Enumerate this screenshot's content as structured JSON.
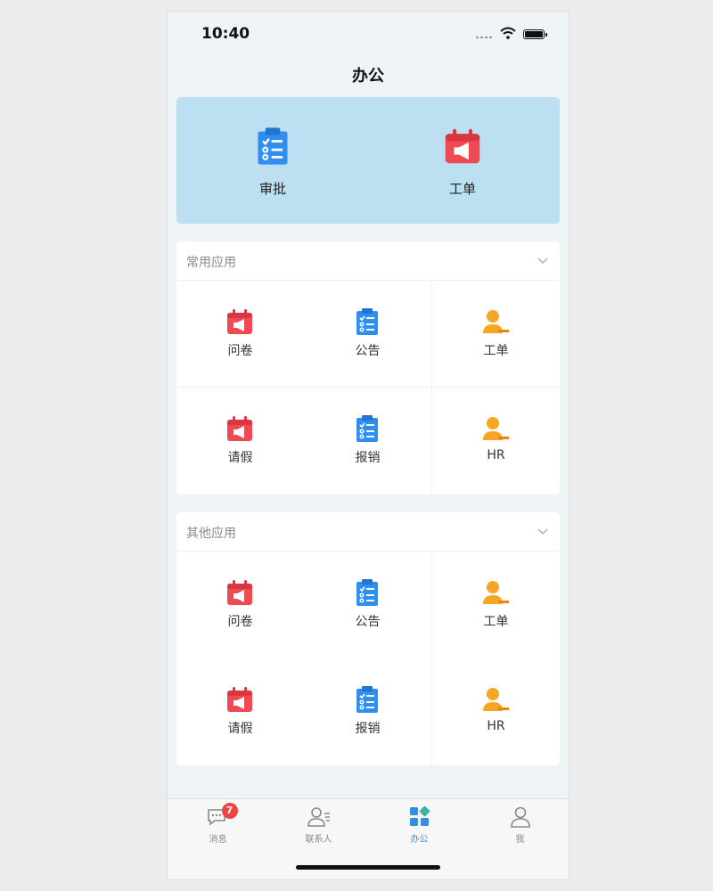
{
  "status_bar": {
    "time": "10:40"
  },
  "header": {
    "title": "办公"
  },
  "hero": {
    "items": [
      {
        "label": "审批",
        "icon": "clipboard-icon",
        "color": "#2f8ff0"
      },
      {
        "label": "工单",
        "icon": "calendar-megaphone-icon",
        "color": "#ef4a52"
      }
    ]
  },
  "common_apps": {
    "title": "常用应用",
    "items": [
      {
        "label": "问卷",
        "icon": "calendar-megaphone-icon"
      },
      {
        "label": "公告",
        "icon": "clipboard-icon"
      },
      {
        "label": "工单",
        "icon": "user-icon"
      },
      {
        "label": "请假",
        "icon": "calendar-megaphone-icon"
      },
      {
        "label": "报销",
        "icon": "clipboard-icon"
      },
      {
        "label": "HR",
        "icon": "user-icon"
      }
    ]
  },
  "other_apps": {
    "title": "其他应用",
    "items": [
      {
        "label": "问卷",
        "icon": "calendar-megaphone-icon"
      },
      {
        "label": "公告",
        "icon": "clipboard-icon"
      },
      {
        "label": "工单",
        "icon": "user-icon"
      },
      {
        "label": "请假",
        "icon": "calendar-megaphone-icon"
      },
      {
        "label": "报销",
        "icon": "clipboard-icon"
      },
      {
        "label": "HR",
        "icon": "user-icon"
      }
    ]
  },
  "tabbar": {
    "tabs": [
      {
        "label": "消息",
        "icon": "chat-icon",
        "badge": "7"
      },
      {
        "label": "联系人",
        "icon": "contacts-icon"
      },
      {
        "label": "办公",
        "icon": "apps-grid-icon",
        "active": true
      },
      {
        "label": "我",
        "icon": "person-icon"
      }
    ]
  },
  "colors": {
    "red": "#ef4a52",
    "blue": "#2f8ff0",
    "orange": "#f5a623",
    "hero_bg": "#bcdff2",
    "active_tab": "#3b8be0"
  }
}
